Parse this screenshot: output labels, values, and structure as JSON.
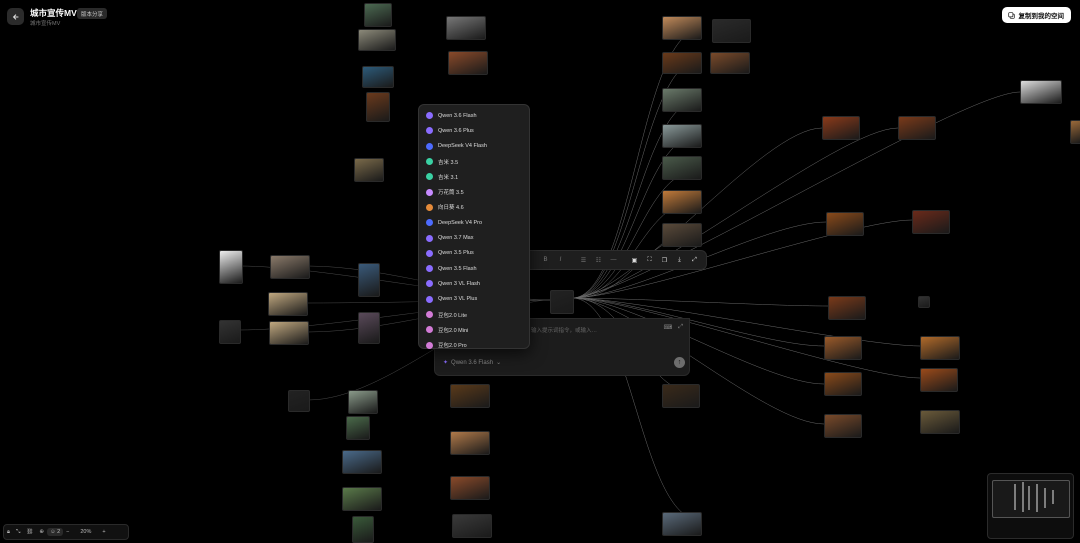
{
  "header": {
    "title": "城市宣传MV",
    "badge": "版本分享",
    "subtitle": "城市宣传MV",
    "copy_button": "复制到我的空间"
  },
  "model_menu": {
    "items": [
      {
        "label": "Qwen 3.6 Flash",
        "icon": "qwen-icon",
        "color": "#8a6cff"
      },
      {
        "label": "Qwen 3.6 Plus",
        "icon": "qwen-icon",
        "color": "#8a6cff"
      },
      {
        "label": "DeepSeek V4 Flash",
        "icon": "deepseek-icon",
        "color": "#4d6bfe"
      },
      {
        "label": "吉米 3.5",
        "icon": "play-icon",
        "color": "#3ad1a3"
      },
      {
        "label": "吉米 3.1",
        "icon": "play-icon",
        "color": "#3ad1a3"
      },
      {
        "label": "万花筒 3.5",
        "icon": "flower-icon",
        "color": "#c78bff"
      },
      {
        "label": "向日葵 4.6",
        "icon": "sunflower-icon",
        "color": "#e58b3a"
      },
      {
        "label": "DeepSeek V4 Pro",
        "icon": "deepseek-icon",
        "color": "#4d6bfe"
      },
      {
        "label": "Qwen 3.7 Max",
        "icon": "qwen-icon",
        "color": "#8a6cff"
      },
      {
        "label": "Qwen 3.5 Plus",
        "icon": "qwen-icon",
        "color": "#8a6cff"
      },
      {
        "label": "Qwen 3.5 Flash",
        "icon": "qwen-icon",
        "color": "#8a6cff"
      },
      {
        "label": "Qwen 3 VL Flash",
        "icon": "qwen-icon",
        "color": "#8a6cff"
      },
      {
        "label": "Qwen 3 VL Plus",
        "icon": "qwen-icon",
        "color": "#8a6cff"
      },
      {
        "label": "豆包2.0 Lite",
        "icon": "doubao-icon",
        "color": "#d27bd6"
      },
      {
        "label": "豆包2.0 Mini",
        "icon": "doubao-icon",
        "color": "#d27bd6"
      },
      {
        "label": "豆包2.0 Pro",
        "icon": "doubao-icon",
        "color": "#d27bd6"
      }
    ]
  },
  "input": {
    "placeholder": "输入提示词指令，或输入…",
    "selected_model": "Qwen 3.6 Flash"
  },
  "bottom_bar": {
    "people_count": "2",
    "zoom": "20%"
  },
  "colors": {
    "background": "#000000",
    "panel": "#1f1f1f",
    "accent": "#8a6cff"
  }
}
